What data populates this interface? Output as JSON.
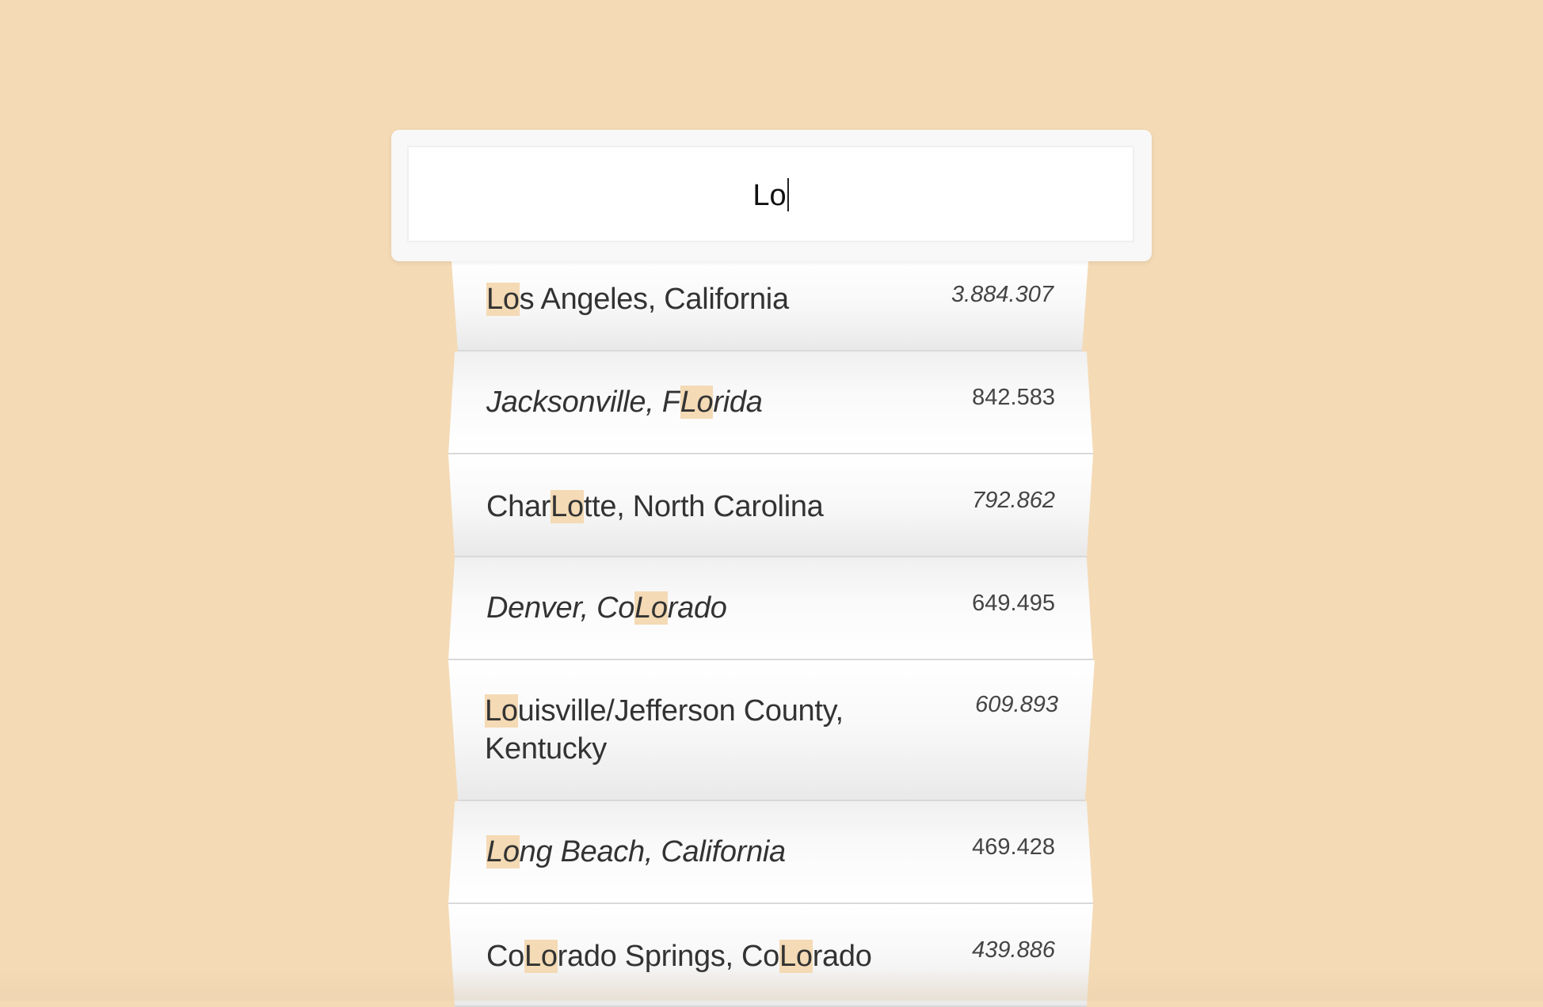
{
  "search": {
    "value": "Lo"
  },
  "results": [
    {
      "pre": "",
      "hl": "Lo",
      "mid": "s Angeles, California",
      "hl2": "",
      "post": "",
      "population": "3.884.307"
    },
    {
      "pre": "Jacksonville, F",
      "hl": "Lo",
      "mid": "rida",
      "hl2": "",
      "post": "",
      "population": "842.583"
    },
    {
      "pre": "Char",
      "hl": "Lo",
      "mid": "tte, North Carolina",
      "hl2": "",
      "post": "",
      "population": "792.862"
    },
    {
      "pre": "Denver, Co",
      "hl": "Lo",
      "mid": "rado",
      "hl2": "",
      "post": "",
      "population": "649.495"
    },
    {
      "pre": "",
      "hl": "Lo",
      "mid": "uisville/Jefferson County,",
      "line2": "Kentucky",
      "hl2": "",
      "post": "",
      "population": "609.893"
    },
    {
      "pre": "",
      "hl": "Lo",
      "mid": "ng Beach, California",
      "hl2": "",
      "post": "",
      "population": "469.428"
    },
    {
      "pre": "Co",
      "hl": "Lo",
      "mid": "rado Springs, Co",
      "hl2": "Lo",
      "post": "rado",
      "population": "439.886"
    }
  ]
}
